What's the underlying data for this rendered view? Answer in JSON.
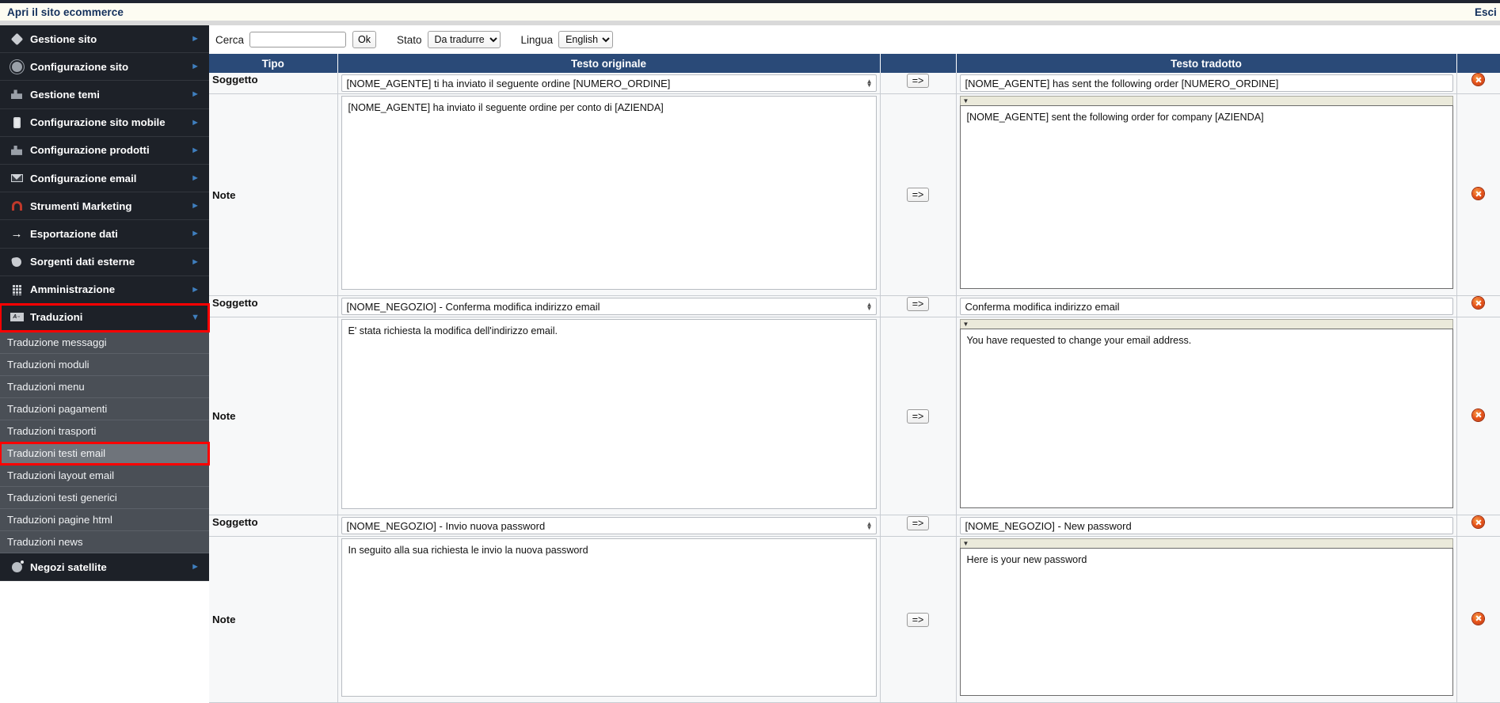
{
  "titlebar": {
    "app_title": "Apri il sito ecommerce",
    "logout_label": "Esci"
  },
  "sidebar": {
    "items": [
      {
        "label": "Gestione sito",
        "icon": "diamond-icon",
        "arrow": "►"
      },
      {
        "label": "Configurazione sito",
        "icon": "gear-icon",
        "arrow": "►"
      },
      {
        "label": "Gestione temi",
        "icon": "theme-icon",
        "arrow": "►"
      },
      {
        "label": "Configurazione sito mobile",
        "icon": "mobile-icon",
        "arrow": "►"
      },
      {
        "label": "Configurazione prodotti",
        "icon": "products-icon",
        "arrow": "►"
      },
      {
        "label": "Configurazione email",
        "icon": "mail-icon",
        "arrow": "►"
      },
      {
        "label": "Strumenti Marketing",
        "icon": "magnet-icon",
        "arrow": "►"
      },
      {
        "label": "Esportazione dati",
        "icon": "export-arrow-icon",
        "arrow": "►"
      },
      {
        "label": "Sorgenti dati esterne",
        "icon": "tag-icon",
        "arrow": "►"
      },
      {
        "label": "Amministrazione",
        "icon": "building-icon",
        "arrow": "►"
      }
    ],
    "expanded": {
      "label": "Traduzioni",
      "icon": "translate-icon",
      "arrow": "▼",
      "children": [
        "Traduzione messaggi",
        "Traduzioni moduli",
        "Traduzioni menu",
        "Traduzioni pagamenti",
        "Traduzioni trasporti",
        "Traduzioni testi email",
        "Traduzioni layout email",
        "Traduzioni testi generici",
        "Traduzioni pagine html",
        "Traduzioni news"
      ],
      "selected_child": "Traduzioni testi email"
    },
    "last_item": {
      "label": "Negozi satellite",
      "icon": "globe-icon",
      "arrow": "►"
    },
    "highlight_color": "#ff0000"
  },
  "toolbar": {
    "search_label": "Cerca",
    "search_value": "",
    "search_placeholder": "",
    "ok_label": "Ok",
    "stato_label": "Stato",
    "stato_value": "Da tradurre",
    "stato_options": [
      "Da tradurre"
    ],
    "lingua_label": "Lingua",
    "lingua_value": "English",
    "lingua_options": [
      "English"
    ]
  },
  "table": {
    "columns": [
      "Tipo",
      "Testo originale",
      "",
      "Testo tradotto",
      ""
    ],
    "copy_button_label": "=>",
    "delete_icon": "delete-circle-icon",
    "rows": [
      {
        "tipo": "Soggetto",
        "originale": "[NOME_AGENTE] ti ha inviato il seguente ordine [NUMERO_ORDINE]",
        "tradotto": "[NOME_AGENTE] has sent the following order [NUMERO_ORDINE]"
      },
      {
        "tipo": "Note",
        "originale": "[NOME_AGENTE] ha inviato il seguente ordine per conto di [AZIENDA]",
        "tradotto": "[NOME_AGENTE] sent the following order for company [AZIENDA]"
      },
      {
        "tipo": "Soggetto",
        "originale": "[NOME_NEGOZIO] - Conferma modifica indirizzo email",
        "tradotto": "Conferma modifica indirizzo email"
      },
      {
        "tipo": "Note",
        "originale": "E' stata richiesta la modifica dell'indirizzo email.",
        "tradotto": "You have requested to change your email address."
      },
      {
        "tipo": "Soggetto",
        "originale": "[NOME_NEGOZIO] - Invio nuova password",
        "tradotto": "[NOME_NEGOZIO] - New password"
      },
      {
        "tipo": "Note",
        "originale": "In seguito alla sua richiesta le invio la nuova password",
        "tradotto": "Here is your new password"
      }
    ]
  },
  "colors": {
    "header_blue": "#2a4a78",
    "sidebar_dark": "#1d2128",
    "sidebar_sub": "#4a4f56",
    "highlight_red": "#ff0000"
  }
}
